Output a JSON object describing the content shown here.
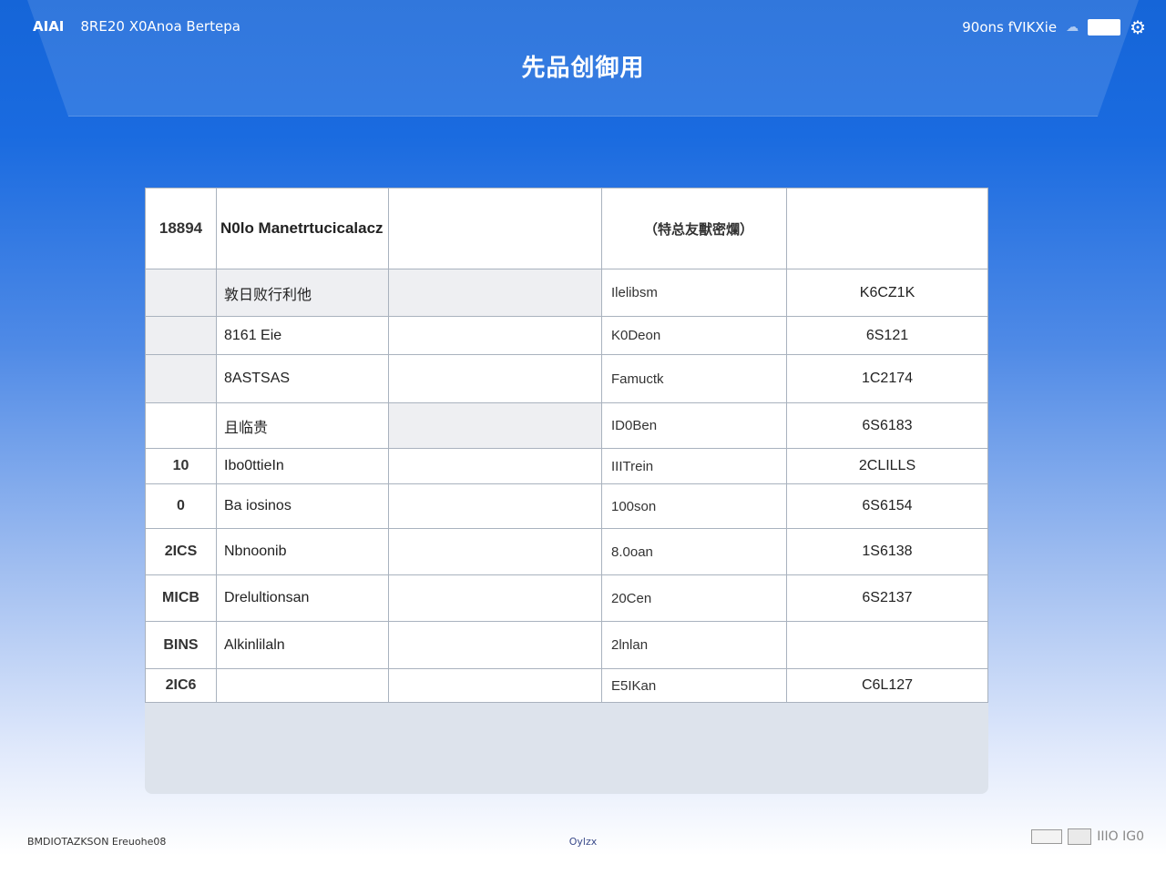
{
  "header": {
    "app_short": "AIAI",
    "app_subtitle": "8RE20 X0Anoa Bertepa",
    "right_text": "90ons fVIKXie",
    "page_title": "先品创御用",
    "gear_icon": "gear-icon",
    "cloud_icon": "cloud-icon"
  },
  "table": {
    "headers": {
      "col0": "18894",
      "col1": "N0lo Manetrtucicalacz",
      "col2": "",
      "col3": "（特总友獸密爛）",
      "col4": ""
    },
    "rows": [
      {
        "idx": "",
        "name": "敦日败行利他",
        "mid": "",
        "val": "Ilelibsm",
        "num": "K6CZ1K"
      },
      {
        "idx": "",
        "name": "8161 Eie",
        "mid": "",
        "val": "K0Deon",
        "num": "6S121"
      },
      {
        "idx": "",
        "name": "8ASTSAS",
        "mid": "",
        "val": "Famuctk",
        "num": "1C2174"
      },
      {
        "idx": "",
        "name": "且临贵",
        "mid": "",
        "val": "ID0Ben",
        "num": "6S6183"
      },
      {
        "idx": "10",
        "name": "Ibo0ttieIn",
        "mid": "",
        "val": "IIITrein",
        "num": "2CLILLS"
      },
      {
        "idx": "0",
        "name": "Ba iosinos",
        "mid": "",
        "val": "100son",
        "num": "6S6154"
      },
      {
        "idx": "2ICS",
        "name": "Nbnoonib",
        "mid": "",
        "val": "8.0oan",
        "num": "1S6138"
      },
      {
        "idx": "MICB",
        "name": "Drelultionsan",
        "mid": "",
        "val": "20Cen",
        "num": "6S2137"
      },
      {
        "idx": "BINS",
        "name": "Alkinlilaln",
        "mid": "",
        "val": "2lnlan",
        "num": ""
      },
      {
        "idx": "2IC6",
        "name": "",
        "mid": "",
        "val": "E5IKan",
        "num": "C6L127"
      }
    ]
  },
  "footer": {
    "left": "BMDIOTAZKSON Ereuohe08",
    "center": "Oylzx",
    "right": "IIIO IG0"
  }
}
